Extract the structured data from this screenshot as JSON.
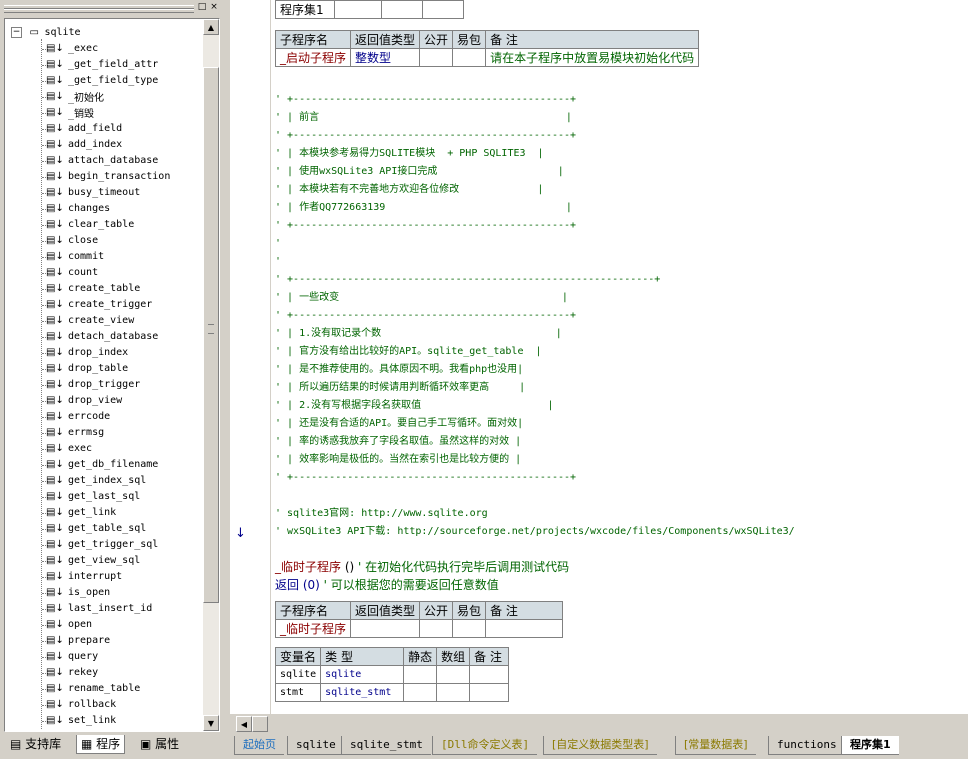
{
  "colors": {
    "background": "#d4d0c8",
    "editor_bg": "#ffffff",
    "header_cell_bg": "#d4dde2",
    "comment": "#006400",
    "keyword_type": "#00008b",
    "subroutine": "#8b0000",
    "tab_blue": "#1e6fbf",
    "tab_olive": "#8b7a00"
  },
  "left_panel": {
    "title_buttons": [
      "□",
      "×"
    ],
    "tree": {
      "root": "sqlite",
      "root_expander": "−",
      "items": [
        "_exec",
        "_get_field_attr",
        "_get_field_type",
        "_初始化",
        "_销毁",
        "add_field",
        "add_index",
        "attach_database",
        "begin_transaction",
        "busy_timeout",
        "changes",
        "clear_table",
        "close",
        "commit",
        "count",
        "create_table",
        "create_trigger",
        "create_view",
        "detach_database",
        "drop_index",
        "drop_table",
        "drop_trigger",
        "drop_view",
        "errcode",
        "errmsg",
        "exec",
        "get_db_filename",
        "get_index_sql",
        "get_last_sql",
        "get_link",
        "get_table_sql",
        "get_trigger_sql",
        "get_view_sql",
        "interrupt",
        "is_open",
        "last_insert_id",
        "open",
        "prepare",
        "query",
        "rekey",
        "rename_table",
        "rollback",
        "set_link"
      ]
    },
    "tabs": [
      {
        "icon": "library-icon",
        "label": "支持库"
      },
      {
        "icon": "program-icon",
        "label": "程序"
      },
      {
        "icon": "properties-icon",
        "label": "属性"
      }
    ]
  },
  "editor": {
    "top_table": {
      "cell": "程序集1"
    },
    "sub_table_1": {
      "headers": [
        "子程序名",
        "返回值类型",
        "公开",
        "易包",
        "备 注"
      ],
      "row": [
        "_启动子程序",
        "整数型",
        "",
        "",
        "请在本子程序中放置易模块初始化代码"
      ]
    },
    "comment_block_1": [
      "' +----------------------------------------------+",
      "' | 前言                                         |",
      "' +----------------------------------------------+",
      "' | 本模块参考易得力SQLITE模块  + PHP SQLITE3  |",
      "' | 使用wxSQLite3 API接口完成                    |",
      "' | 本模块若有不完善地方欢迎各位修改             |",
      "' | 作者QQ772663139                              |",
      "' +----------------------------------------------+",
      "'"
    ],
    "comment_block_2": [
      "'",
      "' +------------------------------------------------------------+",
      "' | 一些改变                                     |",
      "' +----------------------------------------------+",
      "' | 1.没有取记录个数                             |",
      "' | 官方没有给出比较好的API。sqlite_get_table  |",
      "' | 是不推荐使用的。具体原因不明。我看php也没用|",
      "' | 所以遍历结果的时候请用判断循环效率更高     |",
      "' | 2.没有写根据字段名获取值                     |",
      "' | 还是没有合适的API。要自己手工写循环。面对效|",
      "' | 率的诱惑我放弃了字段名取值。虽然这样的对效 |",
      "' | 效率影响是极低的。当然在索引也是比较方便的 |",
      "' +----------------------------------------------+"
    ],
    "links": [
      "' sqlite3官网: http://www.sqlite.org",
      "' wxSQLite3 API下载: http://sourceforge.net/projects/wxcode/files/Components/wxSQLite3/"
    ],
    "temp_sub_line": {
      "name": "_临时子程序",
      "parens": " () ",
      "comment": " ' 在初始化代码执行完毕后调用测试代码"
    },
    "return_line": {
      "kw": "返回",
      "value": " (0) ",
      "comment": " ' 可以根据您的需要返回任意数值"
    },
    "sub_table_2": {
      "headers": [
        "子程序名",
        "返回值类型",
        "公开",
        "易包",
        "备 注"
      ],
      "row": [
        "_临时子程序",
        "",
        "",
        "",
        ""
      ]
    },
    "var_table": {
      "headers": [
        "变量名",
        "类 型",
        "静态",
        "数组",
        "备 注"
      ],
      "rows": [
        [
          "sqlite",
          "sqlite",
          "",
          "",
          ""
        ],
        [
          "stmt",
          "sqlite_stmt",
          "",
          "",
          ""
        ]
      ]
    }
  },
  "doc_tabs": [
    "起始页",
    "sqlite",
    "sqlite_stmt",
    "[Dll命令定义表]",
    "[自定义数据类型表]",
    "[常量数据表]",
    "functions",
    "程序集1"
  ]
}
